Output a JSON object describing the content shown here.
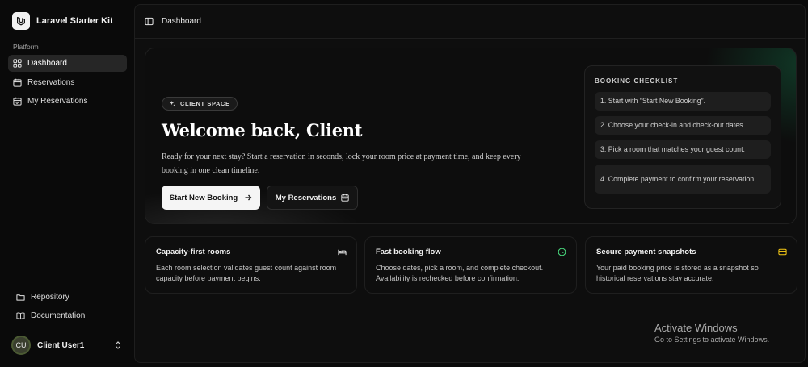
{
  "brand": {
    "name": "Laravel Starter Kit",
    "logo_icon": "laravel-logo-icon"
  },
  "sidebar": {
    "section_label": "Platform",
    "items": [
      {
        "label": "Dashboard",
        "icon": "grid-icon",
        "active": true
      },
      {
        "label": "Reservations",
        "icon": "calendar-icon",
        "active": false
      },
      {
        "label": "My Reservations",
        "icon": "calendar-check-icon",
        "active": false
      }
    ],
    "bottom_items": [
      {
        "label": "Repository",
        "icon": "folder-icon"
      },
      {
        "label": "Documentation",
        "icon": "book-icon"
      }
    ],
    "user": {
      "initials": "CU",
      "name": "Client User1"
    }
  },
  "header": {
    "breadcrumb": "Dashboard"
  },
  "hero": {
    "badge": "CLIENT SPACE",
    "title": "Welcome back, Client",
    "description": "Ready for your next stay? Start a reservation in seconds, lock your room price at payment time, and keep every booking in one clean timeline.",
    "primary_button": "Start New Booking",
    "secondary_button": "My Reservations"
  },
  "checklist": {
    "title": "BOOKING CHECKLIST",
    "items": [
      "1. Start with “Start New Booking”.",
      "2. Choose your check-in and check-out dates.",
      "3. Pick a room that matches your guest count.",
      "4. Complete payment to confirm your reservation."
    ]
  },
  "cards": [
    {
      "title": "Capacity-first rooms",
      "description": "Each room selection validates guest count against room capacity before payment begins.",
      "icon": "bed-icon",
      "icon_color": "#e8e8e8"
    },
    {
      "title": "Fast booking flow",
      "description": "Choose dates, pick a room, and complete checkout. Availability is rechecked before confirmation.",
      "icon": "clock-icon",
      "icon_color": "#4ade80"
    },
    {
      "title": "Secure payment snapshots",
      "description": "Your paid booking price is stored as a snapshot so historical reservations stay accurate.",
      "icon": "credit-card-icon",
      "icon_color": "#facc15"
    }
  ],
  "watermark": {
    "title": "Activate Windows",
    "subtitle": "Go to Settings to activate Windows."
  }
}
